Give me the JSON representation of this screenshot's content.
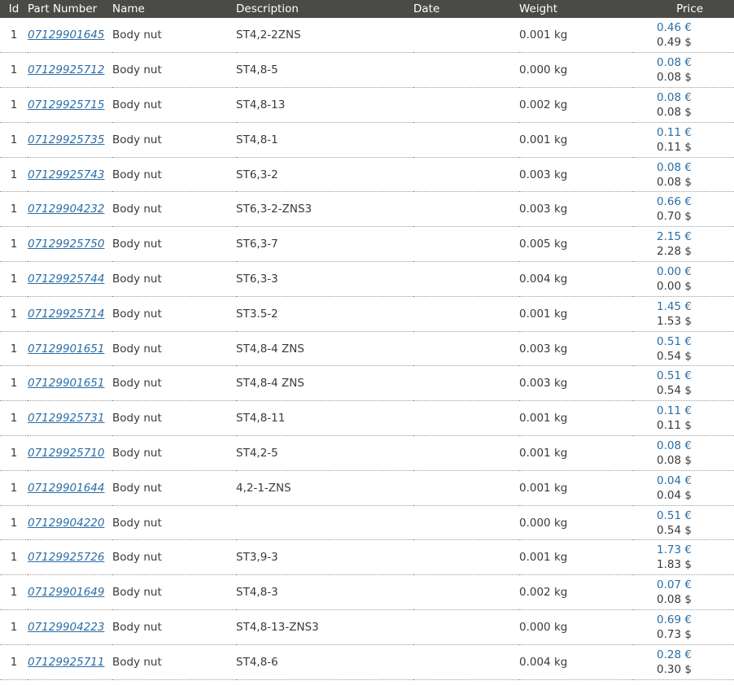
{
  "headers": {
    "id": "Id",
    "part_number": "Part Number",
    "name": "Name",
    "description": "Description",
    "date": "Date",
    "weight": "Weight",
    "price": "Price"
  },
  "rows": [
    {
      "id": "1",
      "part_number": "07129901645",
      "name": "Body nut",
      "description": "ST4,2-2ZNS",
      "date": "",
      "weight": "0.001 kg",
      "price_eur": "0.46 €",
      "price_usd": "0.49 $"
    },
    {
      "id": "1",
      "part_number": "07129925712",
      "name": "Body nut",
      "description": "ST4,8-5",
      "date": "",
      "weight": "0.000 kg",
      "price_eur": "0.08 €",
      "price_usd": "0.08 $"
    },
    {
      "id": "1",
      "part_number": "07129925715",
      "name": "Body nut",
      "description": "ST4,8-13",
      "date": "",
      "weight": "0.002 kg",
      "price_eur": "0.08 €",
      "price_usd": "0.08 $"
    },
    {
      "id": "1",
      "part_number": "07129925735",
      "name": "Body nut",
      "description": "ST4,8-1",
      "date": "",
      "weight": "0.001 kg",
      "price_eur": "0.11 €",
      "price_usd": "0.11 $"
    },
    {
      "id": "1",
      "part_number": "07129925743",
      "name": "Body nut",
      "description": "ST6,3-2",
      "date": "",
      "weight": "0.003 kg",
      "price_eur": "0.08 €",
      "price_usd": "0.08 $"
    },
    {
      "id": "1",
      "part_number": "07129904232",
      "name": "Body nut",
      "description": "ST6,3-2-ZNS3",
      "date": "",
      "weight": "0.003 kg",
      "price_eur": "0.66 €",
      "price_usd": "0.70 $"
    },
    {
      "id": "1",
      "part_number": "07129925750",
      "name": "Body nut",
      "description": "ST6,3-7",
      "date": "",
      "weight": "0.005 kg",
      "price_eur": "2.15 €",
      "price_usd": "2.28 $"
    },
    {
      "id": "1",
      "part_number": "07129925744",
      "name": "Body nut",
      "description": "ST6,3-3",
      "date": "",
      "weight": "0.004 kg",
      "price_eur": "0.00 €",
      "price_usd": "0.00 $"
    },
    {
      "id": "1",
      "part_number": "07129925714",
      "name": "Body nut",
      "description": "ST3.5-2",
      "date": "",
      "weight": "0.001 kg",
      "price_eur": "1.45 €",
      "price_usd": "1.53 $"
    },
    {
      "id": "1",
      "part_number": "07129901651",
      "name": "Body nut",
      "description": "ST4,8-4 ZNS",
      "date": "",
      "weight": "0.003 kg",
      "price_eur": "0.51 €",
      "price_usd": "0.54 $"
    },
    {
      "id": "1",
      "part_number": "07129901651",
      "name": "Body nut",
      "description": "ST4,8-4 ZNS",
      "date": "",
      "weight": "0.003 kg",
      "price_eur": "0.51 €",
      "price_usd": "0.54 $"
    },
    {
      "id": "1",
      "part_number": "07129925731",
      "name": "Body nut",
      "description": "ST4,8-11",
      "date": "",
      "weight": "0.001 kg",
      "price_eur": "0.11 €",
      "price_usd": "0.11 $"
    },
    {
      "id": "1",
      "part_number": "07129925710",
      "name": "Body nut",
      "description": "ST4,2-5",
      "date": "",
      "weight": "0.001 kg",
      "price_eur": "0.08 €",
      "price_usd": "0.08 $"
    },
    {
      "id": "1",
      "part_number": "07129901644",
      "name": "Body nut",
      "description": "4,2-1-ZNS",
      "date": "",
      "weight": "0.001 kg",
      "price_eur": "0.04 €",
      "price_usd": "0.04 $"
    },
    {
      "id": "1",
      "part_number": "07129904220",
      "name": "Body nut",
      "description": "",
      "date": "",
      "weight": "0.000 kg",
      "price_eur": "0.51 €",
      "price_usd": "0.54 $"
    },
    {
      "id": "1",
      "part_number": "07129925726",
      "name": "Body nut",
      "description": "ST3,9-3",
      "date": "",
      "weight": "0.001 kg",
      "price_eur": "1.73 €",
      "price_usd": "1.83 $"
    },
    {
      "id": "1",
      "part_number": "07129901649",
      "name": "Body nut",
      "description": "ST4,8-3",
      "date": "",
      "weight": "0.002 kg",
      "price_eur": "0.07 €",
      "price_usd": "0.08 $"
    },
    {
      "id": "1",
      "part_number": "07129904223",
      "name": "Body nut",
      "description": "ST4,8-13-ZNS3",
      "date": "",
      "weight": "0.000 kg",
      "price_eur": "0.69 €",
      "price_usd": "0.73 $"
    },
    {
      "id": "1",
      "part_number": "07129925711",
      "name": "Body nut",
      "description": "ST4,8-6",
      "date": "",
      "weight": "0.004 kg",
      "price_eur": "0.28 €",
      "price_usd": "0.30 $"
    }
  ]
}
